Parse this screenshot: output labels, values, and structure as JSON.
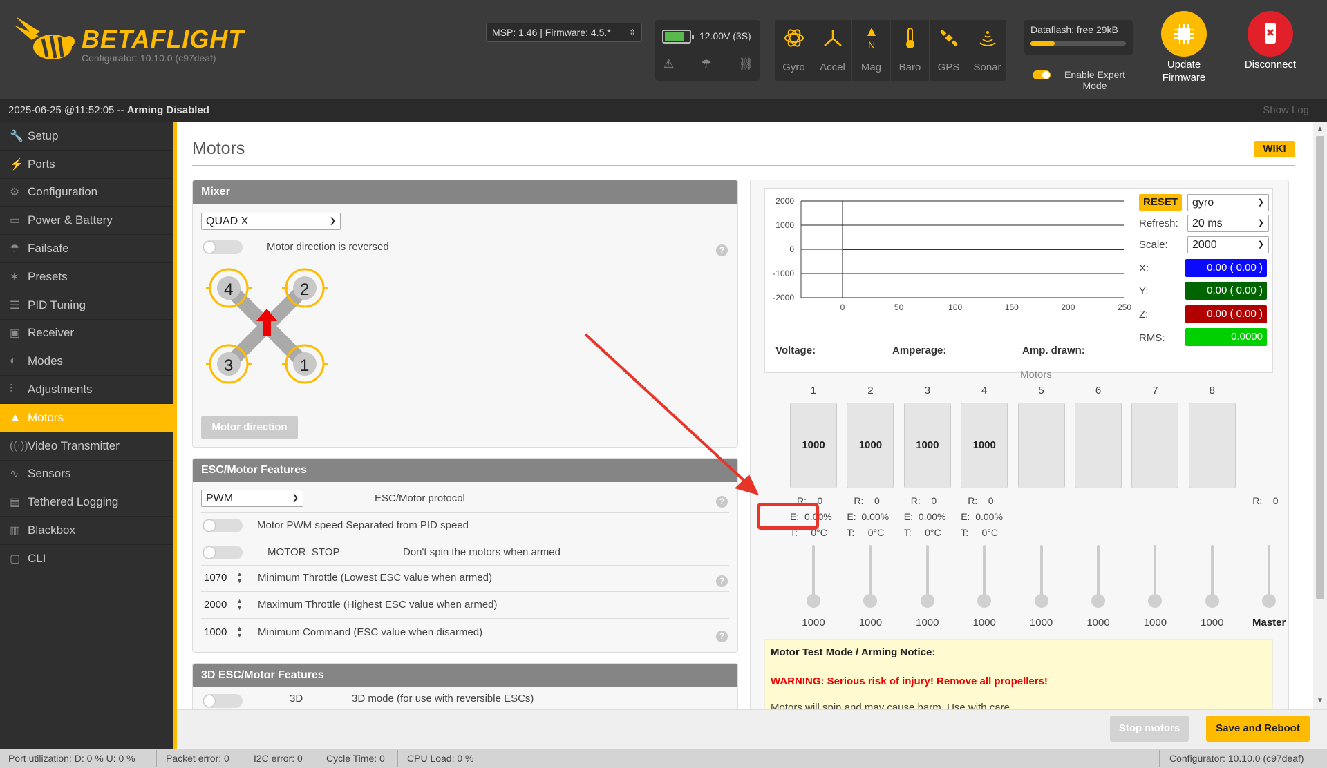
{
  "app": {
    "logo_title": "BETAFLIGHT",
    "logo_subtitle": "Configurator: 10.10.0 (c97deaf)",
    "msp_select": "MSP: 1.46 | Firmware: 4.5.*",
    "battery_text": "12.00V (3S)",
    "battery_level": 0.7,
    "sensors": [
      {
        "label": "Gyro",
        "icon": "gyro-icon"
      },
      {
        "label": "Accel",
        "icon": "accel-icon"
      },
      {
        "label": "Mag",
        "icon": "mag-icon"
      },
      {
        "label": "Baro",
        "icon": "baro-icon"
      },
      {
        "label": "GPS",
        "icon": "gps-icon"
      },
      {
        "label": "Sonar",
        "icon": "sonar-icon"
      }
    ],
    "dataflash_text": "Dataflash: free 29kB",
    "dataflash_used": 0.25,
    "expert_mode_label": "Enable Expert Mode",
    "update_firmware_label": "Update Firmware",
    "disconnect_label": "Disconnect",
    "status_time": "2025-06-25 @11:52:05 -- ",
    "status_arming": "Arming Disabled",
    "show_log": "Show Log",
    "accent_color": "#ffbb00"
  },
  "sidebar": {
    "items": [
      {
        "label": "Setup",
        "icon": "wrench-icon"
      },
      {
        "label": "Ports",
        "icon": "plug-icon"
      },
      {
        "label": "Configuration",
        "icon": "gear-icon"
      },
      {
        "label": "Power & Battery",
        "icon": "battery-icon"
      },
      {
        "label": "Failsafe",
        "icon": "parachute-icon"
      },
      {
        "label": "Presets",
        "icon": "wand-icon"
      },
      {
        "label": "PID Tuning",
        "icon": "sliders-icon"
      },
      {
        "label": "Receiver",
        "icon": "receiver-icon"
      },
      {
        "label": "Modes",
        "icon": "modes-icon"
      },
      {
        "label": "Adjustments",
        "icon": "adjust-icon"
      },
      {
        "label": "Motors",
        "icon": "motor-icon",
        "active": true
      },
      {
        "label": "Video Transmitter",
        "icon": "vtx-icon"
      },
      {
        "label": "Sensors",
        "icon": "sensors-icon"
      },
      {
        "label": "Tethered Logging",
        "icon": "logging-icon"
      },
      {
        "label": "Blackbox",
        "icon": "blackbox-icon"
      },
      {
        "label": "CLI",
        "icon": "terminal-icon"
      }
    ]
  },
  "page": {
    "title": "Motors",
    "wiki": "WIKI"
  },
  "mixer": {
    "header": "Mixer",
    "type": "QUAD X",
    "reversed_label": "Motor direction is reversed",
    "motor_direction_button": "Motor direction",
    "motor_labels": [
      "4",
      "2",
      "3",
      "1"
    ]
  },
  "esc": {
    "header": "ESC/Motor Features",
    "protocol": "PWM",
    "protocol_label": "ESC/Motor protocol",
    "pwm_separated_label": "Motor PWM speed Separated from PID speed",
    "motor_stop_label": "MOTOR_STOP",
    "motor_stop_desc": "Don't spin the motors when armed",
    "min_throttle_value": "1070",
    "min_throttle_label": "Minimum Throttle (Lowest ESC value when armed)",
    "max_throttle_value": "2000",
    "max_throttle_label": "Maximum Throttle (Highest ESC value when armed)",
    "min_command_value": "1000",
    "min_command_label": "Minimum Command (ESC value when disarmed)"
  },
  "esc3d": {
    "header": "3D ESC/Motor Features",
    "partial_label": "3D",
    "partial_desc": "3D mode (for use with reversible ESCs)"
  },
  "graph": {
    "reset": "RESET",
    "sensor": "gyro",
    "refresh_label": "Refresh:",
    "refresh": "20 ms",
    "scale_label": "Scale:",
    "scale": "2000",
    "x_label": "X:",
    "x_value": "0.00 ( 0.00 )",
    "y_label": "Y:",
    "y_value": "0.00 ( 0.00 )",
    "z_label": "Z:",
    "z_value": "0.00 ( 0.00 )",
    "rms_label": "RMS:",
    "rms_value": "0.0000",
    "colors": {
      "x": "#0a0aff",
      "y": "#006400",
      "z": "#b00000",
      "rms": "#00d000"
    },
    "voltage_label": "Voltage:",
    "amperage_label": "Amperage:",
    "amp_drawn_label": "Amp. drawn:"
  },
  "chart_data": {
    "type": "line",
    "title": "",
    "xlabel": "",
    "ylabel": "",
    "x_ticks": [
      "0",
      "50",
      "100",
      "150",
      "200",
      "250"
    ],
    "y_ticks": [
      "2000",
      "1000",
      "0",
      "-1000",
      "-2000"
    ],
    "xlim": [
      0,
      250
    ],
    "ylim": [
      -2000,
      2000
    ],
    "series": [
      {
        "values": [
          0,
          0
        ],
        "x": [
          0,
          250
        ]
      }
    ]
  },
  "motors": {
    "title": "Motors",
    "numbers": [
      "1",
      "2",
      "3",
      "4",
      "5",
      "6",
      "7",
      "8"
    ],
    "values": [
      "1000",
      "1000",
      "1000",
      "1000",
      "",
      "",
      "",
      ""
    ],
    "telemetry": [
      {
        "r": "R:    0",
        "e": "E:  0.00%",
        "t": "T:     0°C"
      },
      {
        "r": "R:    0",
        "e": "E:  0.00%",
        "t": "T:     0°C"
      },
      {
        "r": "R:    0",
        "e": "E:  0.00%",
        "t": "T:     0°C"
      },
      {
        "r": "R:    0",
        "e": "E:  0.00%",
        "t": "T:     0°C"
      }
    ],
    "master_r": "R:    0",
    "slider_values": [
      "1000",
      "1000",
      "1000",
      "1000",
      "1000",
      "1000",
      "1000",
      "1000"
    ],
    "master_label": "Master"
  },
  "notice": {
    "heading": "Motor Test Mode / Arming Notice:",
    "warning": "WARNING: Serious risk of injury! Remove all propellers!",
    "partial": "Motors will spin and may cause harm. Use with care."
  },
  "actions": {
    "stop": "Stop motors",
    "save": "Save and Reboot"
  },
  "bottom": {
    "port_util": "Port utilization: D: 0 % U: 0 %",
    "packet_error": "Packet error: 0",
    "i2c_error": "I2C error: 0",
    "cycle_time": "Cycle Time: 0",
    "cpu_load": "CPU Load: 0 %",
    "configurator": "Configurator: 10.10.0 (c97deaf)"
  }
}
